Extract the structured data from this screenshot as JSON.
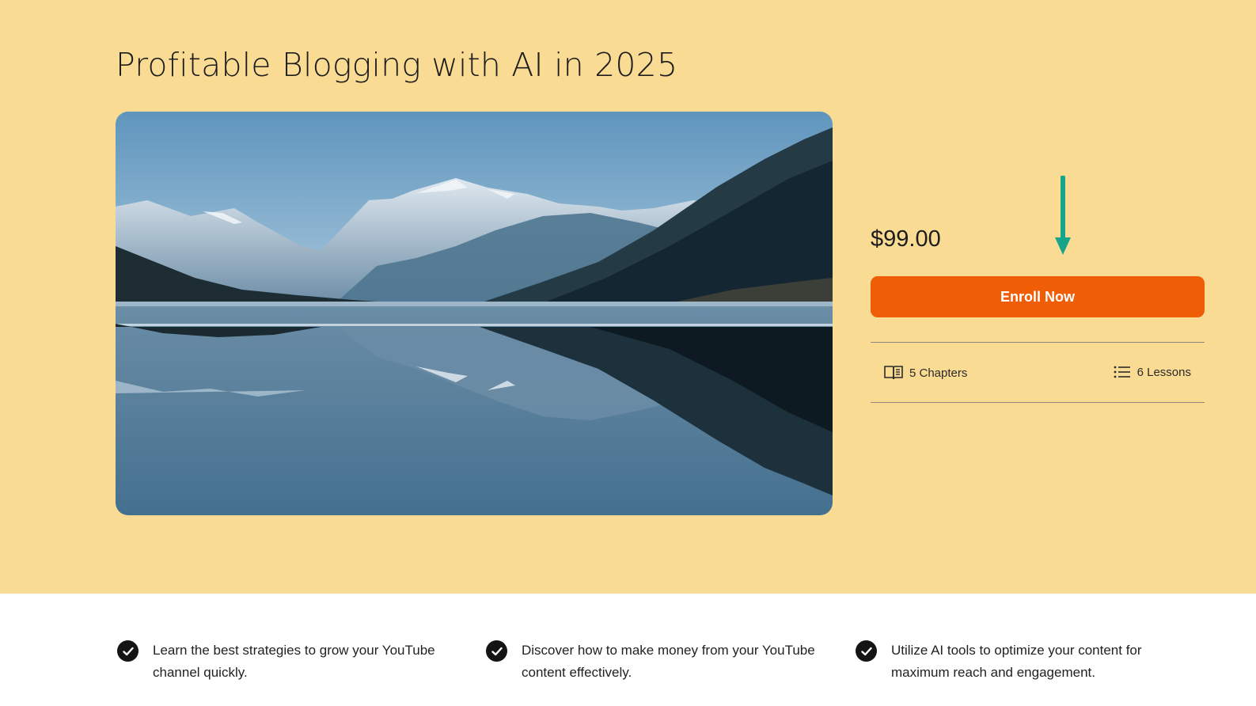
{
  "course": {
    "title": "Profitable Blogging with AI in 2025",
    "cover_image": "mountain-lake-reflection"
  },
  "pricing": {
    "price": "$99.00",
    "enroll_label": "Enroll Now"
  },
  "meta": {
    "chapters_label": "5 Chapters",
    "lessons_label": "6 Lessons"
  },
  "benefits": [
    {
      "text": "Learn the best strategies to grow your YouTube channel quickly."
    },
    {
      "text": "Discover how to make money from your YouTube content effectively."
    },
    {
      "text": "Utilize AI tools to optimize your content for maximum reach and engagement."
    }
  ],
  "icons": {
    "chapters": "open-book-icon",
    "lessons": "list-icon",
    "benefit": "check-circle-icon",
    "annotation": "down-arrow-icon"
  },
  "colors": {
    "hero_background": "#fadb93",
    "accent": "#ef5d06",
    "annotation_arrow": "#16a58a",
    "check_background": "#141414"
  }
}
